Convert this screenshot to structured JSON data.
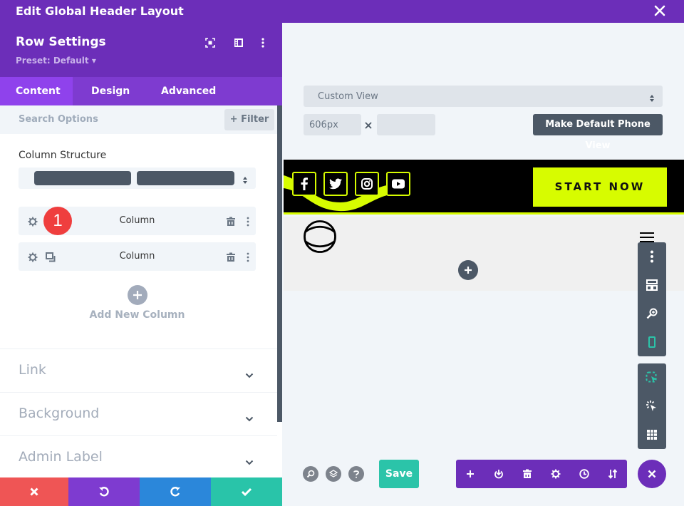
{
  "window": {
    "title": "Edit Global Header Layout",
    "close_icon": "close-icon"
  },
  "panel": {
    "title": "Row Settings",
    "preset": "Preset: Default ▾",
    "header_icons": [
      "expand-icon",
      "sidebar-icon",
      "more-vertical-icon"
    ],
    "tabs": [
      {
        "label": "Content",
        "active": true
      },
      {
        "label": "Design",
        "active": false
      },
      {
        "label": "Advanced",
        "active": false
      }
    ],
    "search_placeholder": "Search Options",
    "filter_label": "+ Filter",
    "column_structure_label": "Column Structure",
    "columns": [
      {
        "label": "Column",
        "badge": "1"
      },
      {
        "label": "Column"
      }
    ],
    "add_column_label": "Add New Column",
    "sections": [
      {
        "label": "Link"
      },
      {
        "label": "Background"
      },
      {
        "label": "Admin Label"
      }
    ],
    "actions": [
      {
        "name": "cancel",
        "color": "#ef5555"
      },
      {
        "name": "undo",
        "color": "#7e3bd0"
      },
      {
        "name": "redo",
        "color": "#2b87da"
      },
      {
        "name": "save",
        "color": "#29c4a9"
      }
    ]
  },
  "preview": {
    "view_select": "Custom View",
    "width_value": "606px",
    "height_value": "",
    "make_default_label": "Make Default Phone View",
    "site": {
      "social_icons": [
        "facebook-icon",
        "twitter-icon",
        "instagram-icon",
        "youtube-icon"
      ],
      "cta_label": "START NOW",
      "accent_color": "#d7fc00"
    }
  },
  "footer": {
    "save_label": "Save"
  },
  "colors": {
    "brand_purple": "#6c2eb9",
    "tab_purple": "#7e3bd0",
    "active_tab": "#8f42ec",
    "dark_gray": "#4c5866",
    "teal": "#2bc4a9",
    "badge_red": "#ef3e3e"
  }
}
